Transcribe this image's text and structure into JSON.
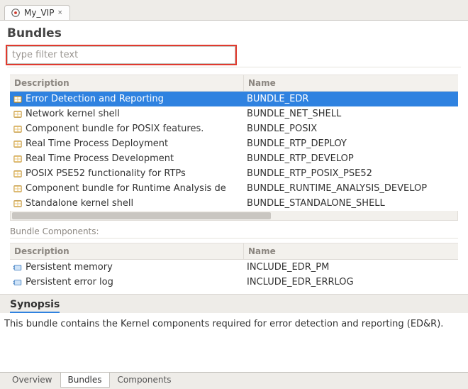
{
  "document_tab": {
    "label": "My_VIP",
    "close_glyph": "×"
  },
  "heading": "Bundles",
  "filter": {
    "placeholder": "type filter text",
    "value": ""
  },
  "bundles_table": {
    "columns": {
      "description": "Description",
      "name": "Name"
    },
    "rows": [
      {
        "icon": "bundle-icon",
        "description": "Error Detection and Reporting",
        "name": "BUNDLE_EDR",
        "selected": true
      },
      {
        "icon": "bundle-icon",
        "description": "Network kernel shell",
        "name": "BUNDLE_NET_SHELL",
        "selected": false
      },
      {
        "icon": "bundle-icon",
        "description": "Component bundle for POSIX features.",
        "name": "BUNDLE_POSIX",
        "selected": false
      },
      {
        "icon": "bundle-icon",
        "description": "Real Time Process Deployment",
        "name": "BUNDLE_RTP_DEPLOY",
        "selected": false
      },
      {
        "icon": "bundle-icon",
        "description": "Real Time Process Development",
        "name": "BUNDLE_RTP_DEVELOP",
        "selected": false
      },
      {
        "icon": "bundle-icon",
        "description": "POSIX PSE52 functionality for RTPs",
        "name": "BUNDLE_RTP_POSIX_PSE52",
        "selected": false
      },
      {
        "icon": "bundle-icon",
        "description": "Component bundle for Runtime Analysis de",
        "name": "BUNDLE_RUNTIME_ANALYSIS_DEVELOP",
        "selected": false
      },
      {
        "icon": "bundle-icon",
        "description": "Standalone kernel shell",
        "name": "BUNDLE_STANDALONE_SHELL",
        "selected": false
      }
    ]
  },
  "components_section": {
    "title": "Bundle Components:",
    "columns": {
      "description": "Description",
      "name": "Name"
    },
    "rows": [
      {
        "icon": "component-icon",
        "description": "Persistent memory",
        "name": "INCLUDE_EDR_PM"
      },
      {
        "icon": "component-icon",
        "description": "Persistent error log",
        "name": "INCLUDE_EDR_ERRLOG"
      }
    ]
  },
  "synopsis": {
    "heading": "Synopsis",
    "body": "This bundle contains the Kernel components required for error detection and reporting (ED&R)."
  },
  "bottom_tabs": {
    "items": [
      {
        "label": "Overview",
        "active": false
      },
      {
        "label": "Bundles",
        "active": true
      },
      {
        "label": "Components",
        "active": false
      }
    ]
  }
}
